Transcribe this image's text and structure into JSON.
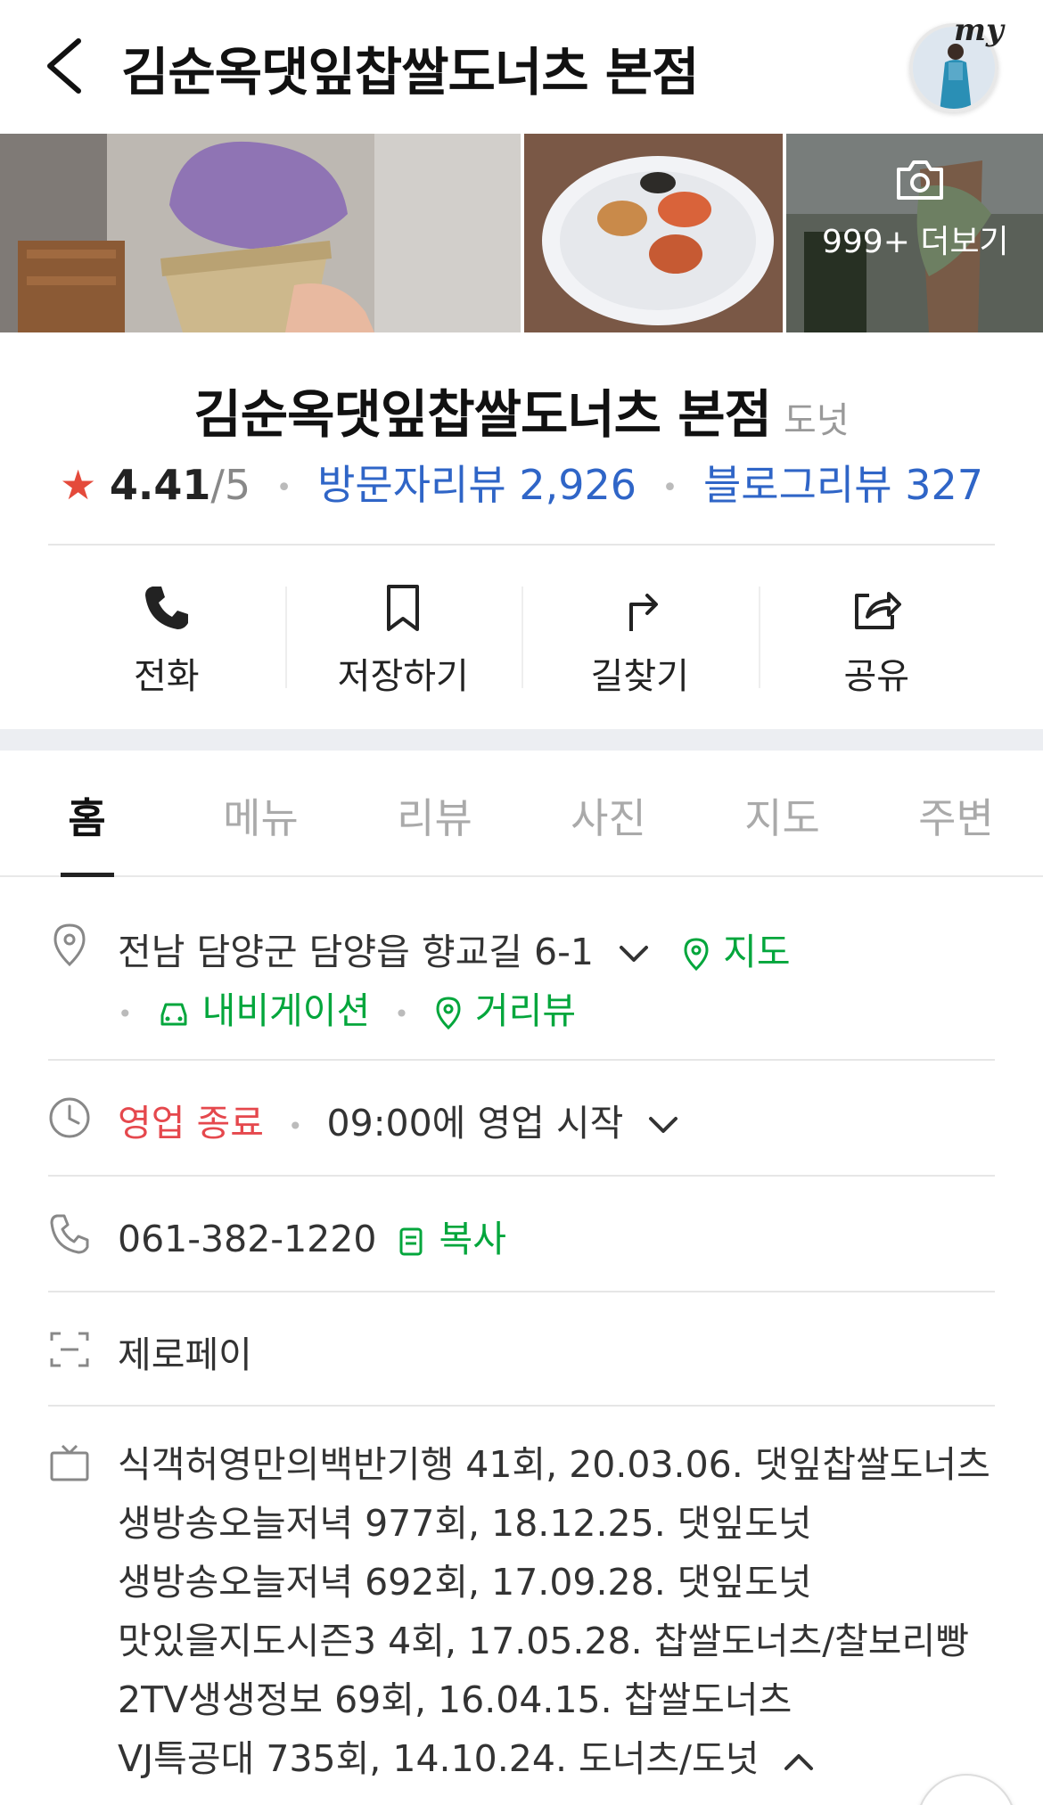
{
  "header": {
    "title": "김순옥댓잎찹쌀도너츠 본점",
    "my_label": "my"
  },
  "photos": {
    "more_label": "999+ 더보기"
  },
  "place": {
    "name": "김순옥댓잎찹쌀도너츠 본점",
    "category": "도넛",
    "rating_star": "★",
    "rating": "4.41",
    "rating_max": "/5",
    "visitor_reviews": "방문자리뷰 2,926",
    "blog_reviews": "블로그리뷰 327"
  },
  "actions": [
    {
      "label": "전화",
      "icon": "phone-icon"
    },
    {
      "label": "저장하기",
      "icon": "bookmark-icon"
    },
    {
      "label": "길찾기",
      "icon": "directions-icon"
    },
    {
      "label": "공유",
      "icon": "share-icon"
    }
  ],
  "tabs": [
    "홈",
    "메뉴",
    "리뷰",
    "사진",
    "지도",
    "주변"
  ],
  "info": {
    "address": "전남 담양군 담양읍 향교길 6-1",
    "map_link": "지도",
    "navigation_link": "내비게이션",
    "streetview_link": "거리뷰",
    "status": "영업 종료",
    "hours": "09:00에 영업 시작",
    "phone": "061-382-1220",
    "copy_label": "복사",
    "payment": "제로페이",
    "broadcasts": [
      "식객허영만의백반기행 41회, 20.03.06. 댓잎찹쌀도너츠",
      "생방송오늘저녁 977회, 18.12.25. 댓잎도넛",
      "생방송오늘저녁 692회, 17.09.28. 댓잎도넛",
      "맛있을지도시즌3 4회, 17.05.28. 찹쌀도너츠/찰보리빵",
      "2TV생생정보 69회, 16.04.15. 찹쌀도너츠",
      "VJ특공대 735회, 14.10.24. 도너츠/도넛"
    ]
  },
  "colors": {
    "accent_green": "#03a63c",
    "link_blue": "#2f65c7",
    "closed_red": "#e5484d",
    "star_red": "#e44a3b"
  }
}
